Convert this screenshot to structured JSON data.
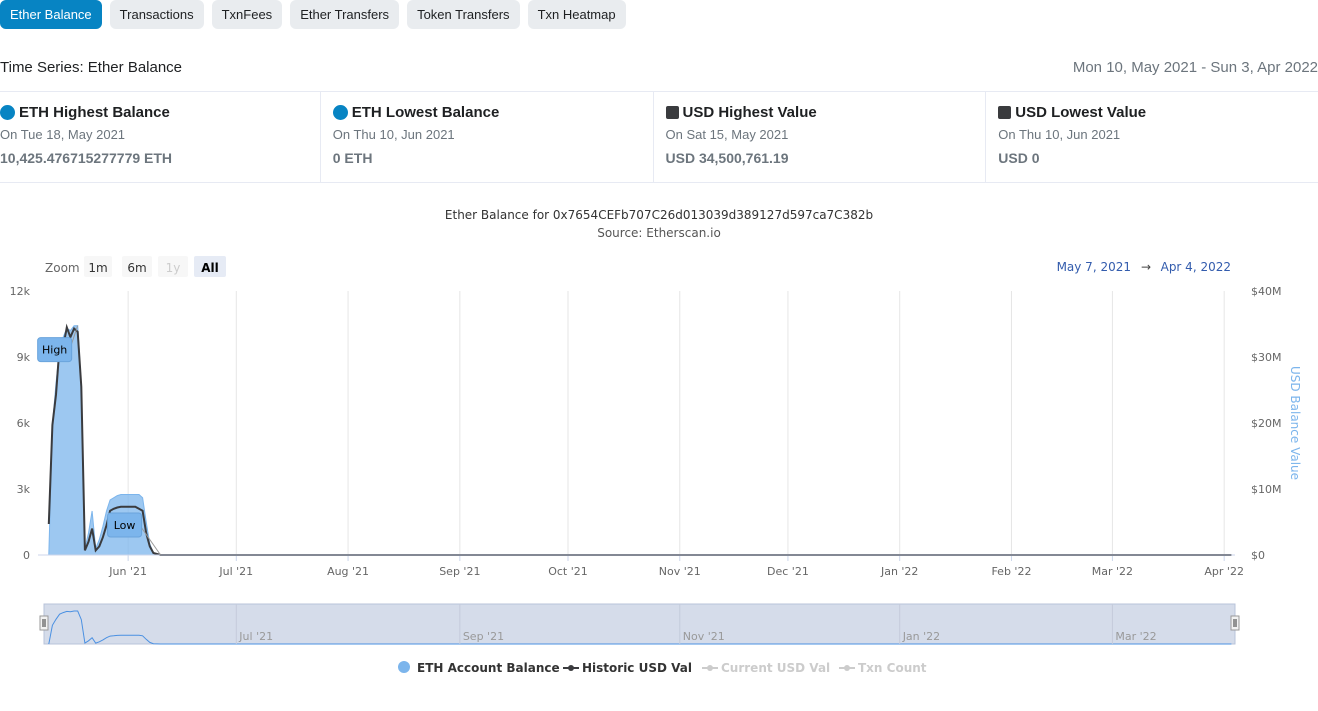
{
  "tabs": [
    {
      "label": "Ether Balance",
      "active": true
    },
    {
      "label": "Transactions",
      "active": false
    },
    {
      "label": "TxnFees",
      "active": false
    },
    {
      "label": "Ether Transfers",
      "active": false
    },
    {
      "label": "Token Transfers",
      "active": false
    },
    {
      "label": "Txn Heatmap",
      "active": false
    }
  ],
  "header": {
    "title": "Time Series: Ether Balance",
    "range": "Mon 10, May 2021 - Sun 3, Apr 2022"
  },
  "stats": [
    {
      "title": "ETH Highest Balance",
      "marker": "dot",
      "color": "#0784c3",
      "date": "On Tue 18, May 2021",
      "value": "10,425.476715277779 ETH"
    },
    {
      "title": "ETH Lowest Balance",
      "marker": "dot",
      "color": "#0784c3",
      "date": "On Thu 10, Jun 2021",
      "value": "0 ETH"
    },
    {
      "title": "USD Highest Value",
      "marker": "square",
      "color": "#3a3b3e",
      "date": "On Sat 15, May 2021",
      "value": "USD 34,500,761.19"
    },
    {
      "title": "USD Lowest Value",
      "marker": "square",
      "color": "#3a3b3e",
      "date": "On Thu 10, Jun 2021",
      "value": "USD 0"
    }
  ],
  "chart_data": {
    "type": "area",
    "title": "Ether Balance for 0x7654CEFb707C26d013039d389127d597ca7C382b",
    "subtitle": "Source: Etherscan.io",
    "zoom": {
      "label": "Zoom",
      "buttons": [
        "1m",
        "6m",
        "1y",
        "All"
      ],
      "selected": "All",
      "disabled": [
        "1y"
      ]
    },
    "range_selector": {
      "from": "May 7, 2021",
      "arrow": "→",
      "to": "Apr 4, 2022"
    },
    "x_range": [
      "2021-05-07",
      "2022-04-04"
    ],
    "x_ticks": [
      {
        "date": "2021-06-01",
        "label": "Jun '21"
      },
      {
        "date": "2021-07-01",
        "label": "Jul '21"
      },
      {
        "date": "2021-08-01",
        "label": "Aug '21"
      },
      {
        "date": "2021-09-01",
        "label": "Sep '21"
      },
      {
        "date": "2021-10-01",
        "label": "Oct '21"
      },
      {
        "date": "2021-11-01",
        "label": "Nov '21"
      },
      {
        "date": "2021-12-01",
        "label": "Dec '21"
      },
      {
        "date": "2022-01-01",
        "label": "Jan '22"
      },
      {
        "date": "2022-02-01",
        "label": "Feb '22"
      },
      {
        "date": "2022-03-01",
        "label": "Mar '22"
      },
      {
        "date": "2022-04-01",
        "label": "Apr '22"
      }
    ],
    "y_left": {
      "min": 0,
      "max": 12000,
      "ticks": [
        0,
        3000,
        6000,
        9000,
        12000
      ],
      "tick_labels": [
        "0",
        "3k",
        "6k",
        "9k",
        "12k"
      ]
    },
    "y_right": {
      "min": 0,
      "max": 40000000,
      "label": "USD Balance Value",
      "ticks": [
        0,
        10000000,
        20000000,
        30000000,
        40000000
      ],
      "tick_labels": [
        "$0",
        "$10M",
        "$20M",
        "$30M",
        "$40M"
      ]
    },
    "grid": true,
    "series": [
      {
        "name": "ETH Account Balance",
        "kind": "area",
        "axis": "left",
        "color": "#7cb5ec",
        "points": [
          [
            "2021-05-10",
            0
          ],
          [
            "2021-05-11",
            5900
          ],
          [
            "2021-05-12",
            7800
          ],
          [
            "2021-05-13",
            9400
          ],
          [
            "2021-05-14",
            9900
          ],
          [
            "2021-05-15",
            10300
          ],
          [
            "2021-05-16",
            10200
          ],
          [
            "2021-05-17",
            10420
          ],
          [
            "2021-05-18",
            10425
          ],
          [
            "2021-05-19",
            7700
          ],
          [
            "2021-05-20",
            300
          ],
          [
            "2021-05-21",
            1000
          ],
          [
            "2021-05-22",
            2000
          ],
          [
            "2021-05-23",
            300
          ],
          [
            "2021-05-24",
            700
          ],
          [
            "2021-05-25",
            1300
          ],
          [
            "2021-05-26",
            2000
          ],
          [
            "2021-05-27",
            2500
          ],
          [
            "2021-05-28",
            2600
          ],
          [
            "2021-05-29",
            2700
          ],
          [
            "2021-05-30",
            2750
          ],
          [
            "2021-06-01",
            2750
          ],
          [
            "2021-06-03",
            2750
          ],
          [
            "2021-06-04",
            2750
          ],
          [
            "2021-06-05",
            2600
          ],
          [
            "2021-06-06",
            1500
          ],
          [
            "2021-06-07",
            500
          ],
          [
            "2021-06-08",
            100
          ],
          [
            "2021-06-10",
            0
          ],
          [
            "2022-04-03",
            0
          ]
        ]
      },
      {
        "name": "Historic USD Val",
        "kind": "line",
        "axis": "right",
        "color": "#3a3b3e",
        "points": [
          [
            "2021-05-10",
            4700000
          ],
          [
            "2021-05-11",
            19700000
          ],
          [
            "2021-05-12",
            24300000
          ],
          [
            "2021-05-13",
            31700000
          ],
          [
            "2021-05-14",
            31500000
          ],
          [
            "2021-05-15",
            34500000
          ],
          [
            "2021-05-16",
            33000000
          ],
          [
            "2021-05-17",
            34300000
          ],
          [
            "2021-05-18",
            33800000
          ],
          [
            "2021-05-19",
            25500000
          ],
          [
            "2021-05-20",
            700000
          ],
          [
            "2021-05-21",
            2000000
          ],
          [
            "2021-05-22",
            4000000
          ],
          [
            "2021-05-23",
            700000
          ],
          [
            "2021-05-24",
            1300000
          ],
          [
            "2021-05-25",
            2700000
          ],
          [
            "2021-05-26",
            4500000
          ],
          [
            "2021-05-27",
            6700000
          ],
          [
            "2021-05-28",
            7000000
          ],
          [
            "2021-05-29",
            7200000
          ],
          [
            "2021-05-30",
            7300000
          ],
          [
            "2021-06-01",
            7300000
          ],
          [
            "2021-06-03",
            7300000
          ],
          [
            "2021-06-04",
            7000000
          ],
          [
            "2021-06-05",
            6700000
          ],
          [
            "2021-06-06",
            3300000
          ],
          [
            "2021-06-07",
            1300000
          ],
          [
            "2021-06-08",
            300000
          ],
          [
            "2021-06-10",
            0
          ],
          [
            "2022-04-03",
            0
          ]
        ]
      },
      {
        "name": "Current USD Val",
        "kind": "line",
        "axis": "right",
        "color": "#cccccc",
        "hidden": true,
        "points": []
      },
      {
        "name": "Txn Count",
        "kind": "line",
        "axis": "right",
        "color": "#cccccc",
        "hidden": true,
        "points": []
      }
    ],
    "flags": [
      {
        "text": "High",
        "date": "2021-05-18",
        "value": 10425
      },
      {
        "text": "Low",
        "date": "2021-06-10",
        "value": 0
      }
    ],
    "navigator_ticks": [
      {
        "date": "2021-07-01",
        "label": "Jul '21"
      },
      {
        "date": "2021-09-01",
        "label": "Sep '21"
      },
      {
        "date": "2021-11-01",
        "label": "Nov '21"
      },
      {
        "date": "2022-01-01",
        "label": "Jan '22"
      },
      {
        "date": "2022-03-01",
        "label": "Mar '22"
      }
    ],
    "legend": {
      "placement": "bottom-center"
    }
  }
}
